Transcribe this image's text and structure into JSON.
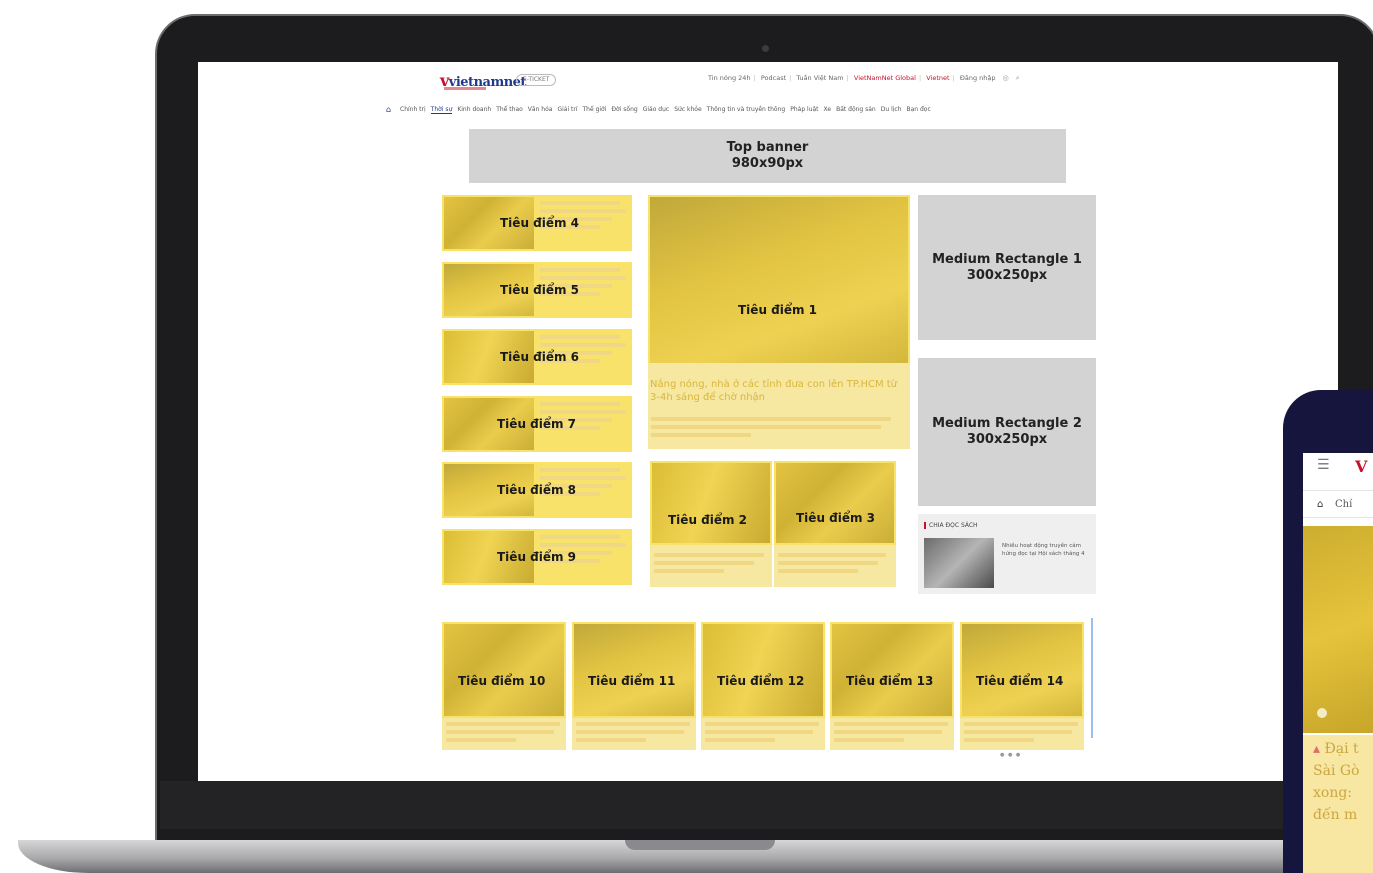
{
  "header": {
    "logo": "vietnamnet",
    "button": "E-TICKET",
    "toplinks": [
      "Tin nóng 24h",
      "Podcast",
      "Tuần Việt Nam"
    ],
    "toplinks_red": "VietNamNet Global",
    "toplinks_extra": [
      "Vietnet",
      "Đăng nhập"
    ]
  },
  "nav": {
    "items": [
      "Chính trị",
      "Thời sự",
      "Kinh doanh",
      "Thể thao",
      "Văn hóa",
      "Giải trí",
      "Thế giới",
      "Đời sống",
      "Giáo dục",
      "Sức khỏe",
      "Thông tin và truyền thông",
      "Pháp luật",
      "Xe",
      "Bất động sản",
      "Du lịch",
      "Bạn đọc"
    ],
    "active_index": 1
  },
  "ads": {
    "top_banner": {
      "title": "Top banner",
      "size": "980x90px"
    },
    "medium_rect_1": {
      "title": "Medium Rectangle 1",
      "size": "300x250px"
    },
    "medium_rect_2": {
      "title": "Medium Rectangle 2",
      "size": "300x250px"
    }
  },
  "focus": {
    "main": "Tiêu điểm 1",
    "main_title": "Nắng nóng, nhà ở các tỉnh đưa con lên TP.HCM từ 3-4h sáng để chờ nhận",
    "left": [
      "Tiêu điểm 4",
      "Tiêu điểm 5",
      "Tiêu điểm 6",
      "Tiêu điểm 7",
      "Tiêu điểm 8",
      "Tiêu điểm 9"
    ],
    "mid": [
      "Tiêu điểm 2",
      "Tiêu điểm 3"
    ],
    "bottom": [
      "Tiêu điểm 10",
      "Tiêu điểm 11",
      "Tiêu điểm 12",
      "Tiêu điểm 13",
      "Tiêu điểm 14"
    ]
  },
  "book": {
    "heading": "CHIA ĐỌC SÁCH",
    "text": "Nhiều hoạt động truyền cảm hứng đọc tại Hội sách tháng 4"
  },
  "phone": {
    "menu_icon": "☰",
    "logo": "V",
    "nav_text": "Chí",
    "headline_lines": [
      "Đại t",
      "Sài Gò",
      "xong:",
      "đến m"
    ]
  },
  "colors": {
    "highlight": "#fadd3c",
    "ad_gray": "#d3d3d3",
    "brand_red": "#c8102e",
    "brand_blue": "#1f3a8a",
    "laptop": "#1c1c1e",
    "phone": "#15153d"
  }
}
